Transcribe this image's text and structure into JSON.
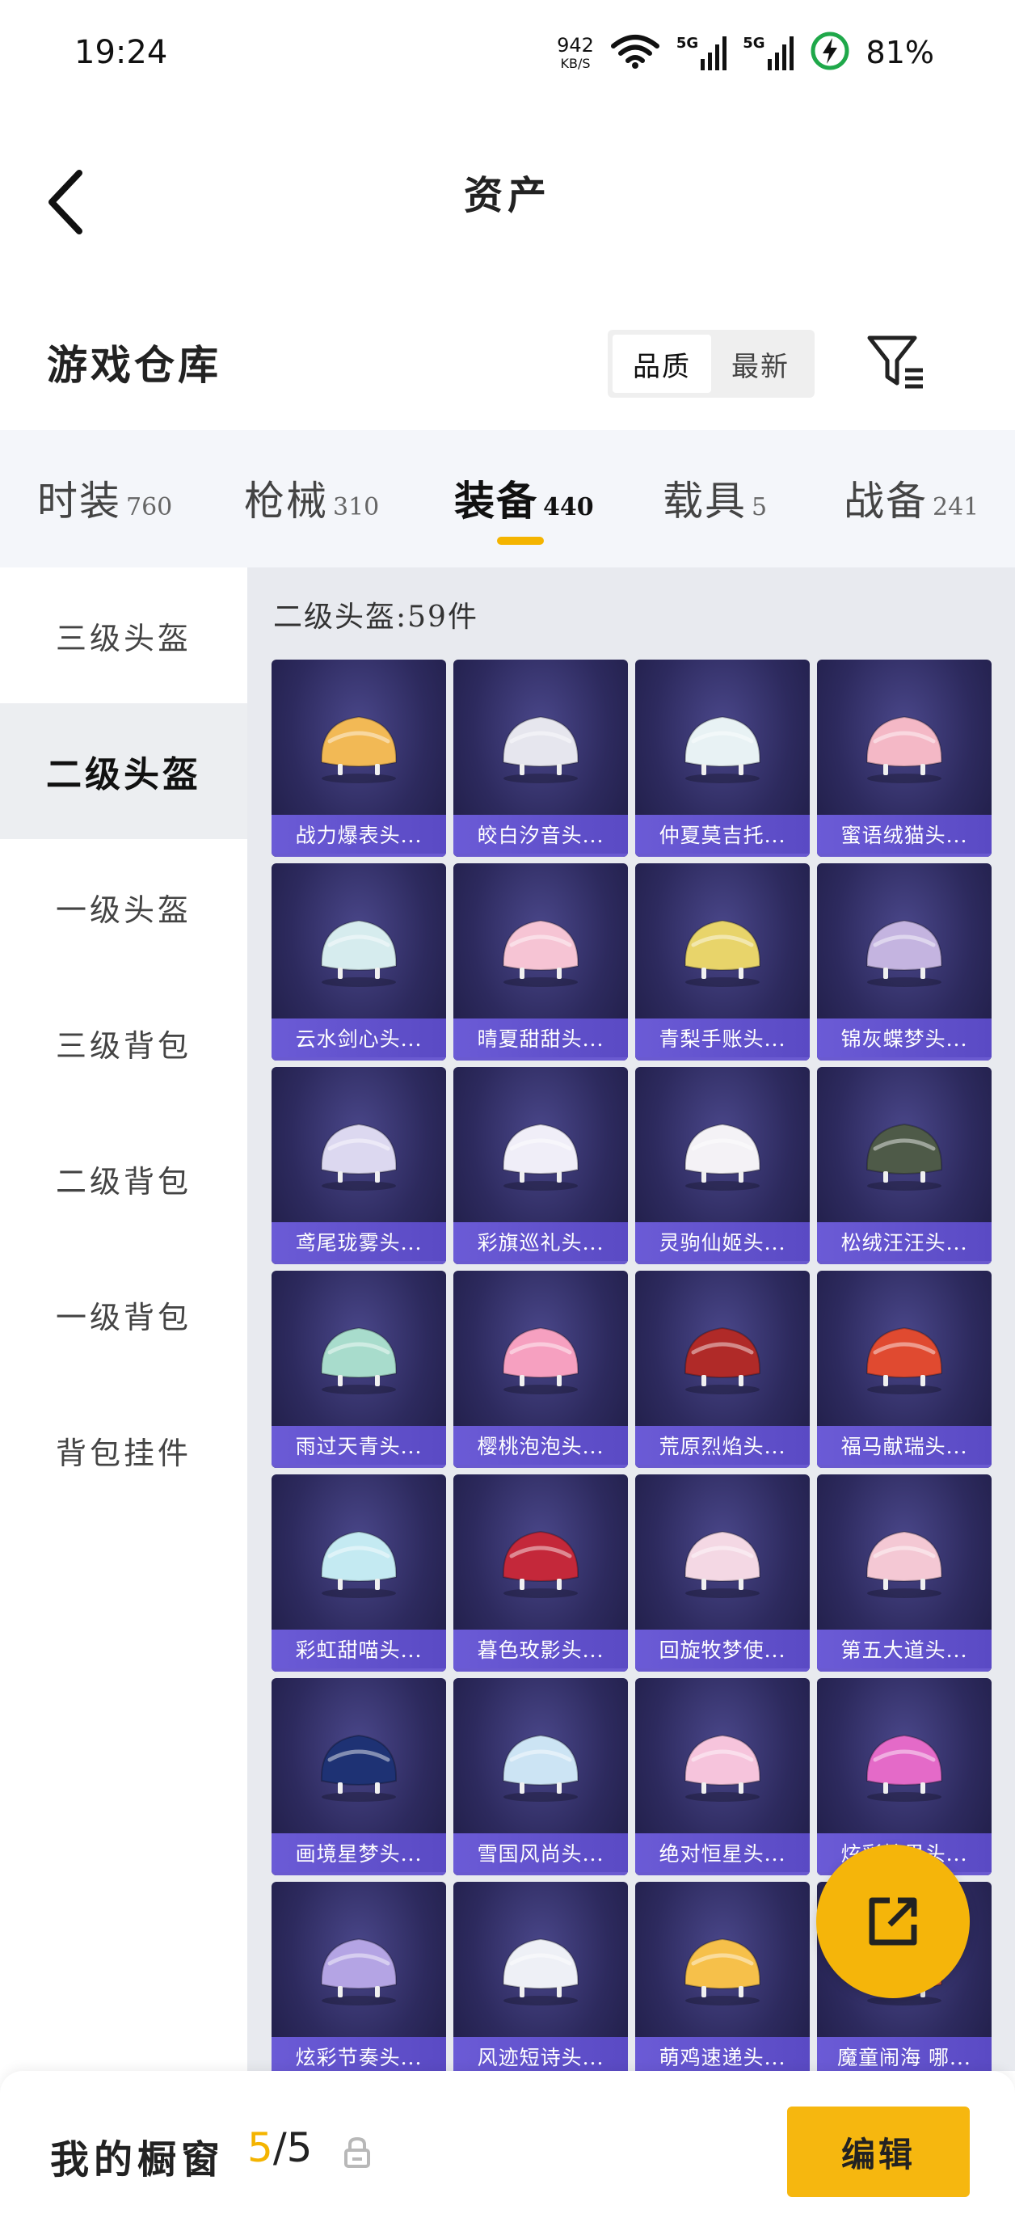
{
  "status_bar": {
    "time": "19:24",
    "net_speed": "942",
    "net_unit": "KB/S",
    "sim1": "5G",
    "sim2": "5G",
    "battery": "81%"
  },
  "header": {
    "title": "资产",
    "back_icon": "chevron-left-icon"
  },
  "section": {
    "title": "游戏仓库",
    "sort_options": [
      "品质",
      "最新"
    ],
    "sort_active": "品质",
    "filter_icon": "filter-icon"
  },
  "categories": [
    {
      "label": "时装",
      "count": "760"
    },
    {
      "label": "枪械",
      "count": "310"
    },
    {
      "label": "装备",
      "count": "440",
      "active": true
    },
    {
      "label": "载具",
      "count": "5"
    },
    {
      "label": "战备",
      "count": "241"
    }
  ],
  "side_nav": [
    {
      "label": "三级头盔"
    },
    {
      "label": "二级头盔",
      "active": true
    },
    {
      "label": "一级头盔"
    },
    {
      "label": "三级背包"
    },
    {
      "label": "二级背包"
    },
    {
      "label": "一级背包"
    },
    {
      "label": "背包挂件"
    }
  ],
  "content": {
    "count_label": "二级头盔:59件",
    "items": [
      {
        "name": "战力爆表头...",
        "color": "#f2b955"
      },
      {
        "name": "皎白汐音头...",
        "color": "#e6e6ee"
      },
      {
        "name": "仲夏莫吉托...",
        "color": "#e8f2f4"
      },
      {
        "name": "蜜语绒猫头...",
        "color": "#f4b8c6"
      },
      {
        "name": "云水剑心头...",
        "color": "#d6ecee"
      },
      {
        "name": "晴夏甜甜头...",
        "color": "#f6c4d4"
      },
      {
        "name": "青梨手账头...",
        "color": "#e8d46a"
      },
      {
        "name": "锦灰蝶梦头...",
        "color": "#c4b4e0"
      },
      {
        "name": "鸢尾珑雾头...",
        "color": "#dcd8f0"
      },
      {
        "name": "彩旗巡礼头...",
        "color": "#f0eef8"
      },
      {
        "name": "灵驹仙姬头...",
        "color": "#f4f2f6"
      },
      {
        "name": "松绒汪汪头...",
        "color": "#4e5a48"
      },
      {
        "name": "雨过天青头...",
        "color": "#a8dccc"
      },
      {
        "name": "樱桃泡泡头...",
        "color": "#f6a0c0"
      },
      {
        "name": "荒原烈焰头...",
        "color": "#b02a28"
      },
      {
        "name": "福马献瑞头...",
        "color": "#e04a30"
      },
      {
        "name": "彩虹甜喵头...",
        "color": "#c4eaf2"
      },
      {
        "name": "暮色玫影头...",
        "color": "#c4283a"
      },
      {
        "name": "回旋牧梦使...",
        "color": "#f4d8e4"
      },
      {
        "name": "第五大道头...",
        "color": "#f4c8d4"
      },
      {
        "name": "画境星梦头...",
        "color": "#1e3274"
      },
      {
        "name": "雪国风尚头...",
        "color": "#cce4f4"
      },
      {
        "name": "绝对恒星头...",
        "color": "#f6c4dc"
      },
      {
        "name": "炫彩糖果头...",
        "color": "#e46ac8"
      },
      {
        "name": "炫彩节奏头...",
        "color": "#b4a4e4"
      },
      {
        "name": "风迹短诗头...",
        "color": "#eef0f6"
      },
      {
        "name": "萌鸡速递头...",
        "color": "#f6c04a"
      },
      {
        "name": "魔童闹海 哪...",
        "color": "#d45a3a"
      }
    ]
  },
  "share_icon": "share-external-icon",
  "bottom_bar": {
    "label": "我的橱窗",
    "count_current": "5",
    "count_sep": "/",
    "count_total": "5",
    "lock_icon": "lock-icon",
    "edit_label": "编辑"
  },
  "colors": {
    "accent": "#f4b400",
    "card_bg": "#2d2a5e",
    "card_label": "#6b5bd6"
  }
}
